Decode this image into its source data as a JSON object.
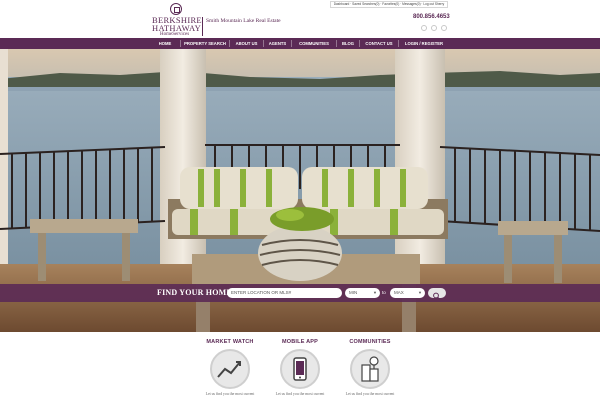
{
  "header": {
    "util_links": "Dashboard · Saved Searches(0) · Favorites(0) · Messages(0) · Log out Sherry",
    "brand_line1": "BERKSHIRE",
    "brand_line2": "HATHAWAY",
    "brand_sub": "HomeServices",
    "office_name": "Smith Mountain Lake Real Estate",
    "phone": "800.856.4653"
  },
  "nav": {
    "items": [
      {
        "label": "HOME"
      },
      {
        "label": "PROPERTY SEARCH"
      },
      {
        "label": "ABOUT US"
      },
      {
        "label": "AGENTS"
      },
      {
        "label": "COMMUNITIES"
      },
      {
        "label": "BLOG"
      },
      {
        "label": "CONTACT US"
      },
      {
        "label": "LOGIN / REGISTER"
      }
    ]
  },
  "search": {
    "title": "FIND YOUR HOME",
    "location_placeholder": "ENTER LOCATION OR MLS#",
    "min_label": "MIN",
    "to_label": "to",
    "max_label": "MAX"
  },
  "features": [
    {
      "title": "MARKET WATCH",
      "text": "Let us find you the most current",
      "icon": "chart-icon"
    },
    {
      "title": "MOBILE APP",
      "text": "Let us find you the most current",
      "icon": "phone-icon"
    },
    {
      "title": "COMMUNITIES",
      "text": "Let us find you the most current",
      "icon": "building-icon"
    }
  ],
  "colors": {
    "brand": "#5b2a55",
    "nav_bg": "#5b2a55"
  }
}
